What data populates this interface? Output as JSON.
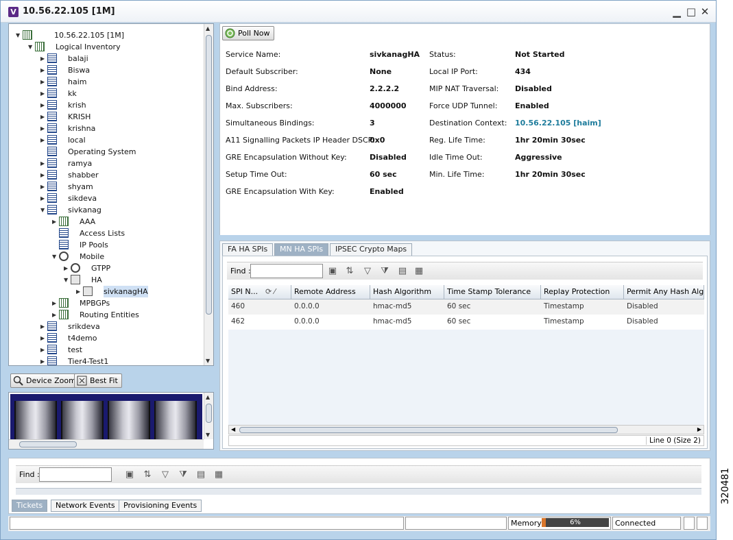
{
  "window": {
    "title": "10.56.22.105 [1M]",
    "icon_letter": "V"
  },
  "tree": [
    {
      "label": "10.56.22.105 [1M]",
      "depth": 0,
      "toggle": "▼",
      "icon": "network-element-icon"
    },
    {
      "label": "Logical Inventory",
      "depth": 1,
      "toggle": "▼",
      "icon": "logical-inventory-icon"
    },
    {
      "label": "balaji",
      "depth": 2,
      "toggle": "▶",
      "icon": "context-icon"
    },
    {
      "label": "Biswa",
      "depth": 2,
      "toggle": "▶",
      "icon": "context-icon"
    },
    {
      "label": "haim",
      "depth": 2,
      "toggle": "▶",
      "icon": "context-icon"
    },
    {
      "label": "kk",
      "depth": 2,
      "toggle": "▶",
      "icon": "context-icon"
    },
    {
      "label": "krish",
      "depth": 2,
      "toggle": "▶",
      "icon": "context-icon"
    },
    {
      "label": "KRISH",
      "depth": 2,
      "toggle": "▶",
      "icon": "context-icon"
    },
    {
      "label": "krishna",
      "depth": 2,
      "toggle": "▶",
      "icon": "context-icon"
    },
    {
      "label": "local",
      "depth": 2,
      "toggle": "▶",
      "icon": "context-icon"
    },
    {
      "label": "Operating System",
      "depth": 2,
      "toggle": "",
      "icon": "operating-system-icon"
    },
    {
      "label": "ramya",
      "depth": 2,
      "toggle": "▶",
      "icon": "context-icon"
    },
    {
      "label": "shabber",
      "depth": 2,
      "toggle": "▶",
      "icon": "context-icon"
    },
    {
      "label": "shyam",
      "depth": 2,
      "toggle": "▶",
      "icon": "context-icon"
    },
    {
      "label": "sikdeva",
      "depth": 2,
      "toggle": "▶",
      "icon": "context-icon"
    },
    {
      "label": "sivkanag",
      "depth": 2,
      "toggle": "▼",
      "icon": "context-icon"
    },
    {
      "label": "AAA",
      "depth": 3,
      "toggle": "▶",
      "icon": "aaa-icon"
    },
    {
      "label": "Access Lists",
      "depth": 3,
      "toggle": "",
      "icon": "access-list-icon"
    },
    {
      "label": "IP Pools",
      "depth": 3,
      "toggle": "",
      "icon": "ip-pool-icon"
    },
    {
      "label": "Mobile",
      "depth": 3,
      "toggle": "▼",
      "icon": "mobile-icon"
    },
    {
      "label": "GTPP",
      "depth": 4,
      "toggle": "▶",
      "icon": "gtpp-icon"
    },
    {
      "label": "HA",
      "depth": 4,
      "toggle": "▼",
      "icon": "ha-icon"
    },
    {
      "label": "sivkanagHA",
      "depth": 5,
      "toggle": "▶",
      "icon": "ha-service-icon",
      "selected": true
    },
    {
      "label": "MPBGPs",
      "depth": 3,
      "toggle": "▶",
      "icon": "mpbgp-icon"
    },
    {
      "label": "Routing Entities",
      "depth": 3,
      "toggle": "▶",
      "icon": "routing-entity-icon"
    },
    {
      "label": "srikdeva",
      "depth": 2,
      "toggle": "▶",
      "icon": "context-icon"
    },
    {
      "label": "t4demo",
      "depth": 2,
      "toggle": "▶",
      "icon": "context-icon"
    },
    {
      "label": "test",
      "depth": 2,
      "toggle": "▶",
      "icon": "context-icon"
    },
    {
      "label": "Tier4-Test1",
      "depth": 2,
      "toggle": "▶",
      "icon": "context-icon"
    }
  ],
  "zoom": {
    "device_zoom": "Device Zoom",
    "best_fit": "Best Fit"
  },
  "detail": {
    "poll_now": "Poll Now",
    "left_props": [
      {
        "label": "Service Name:",
        "value": "sivkanagHA"
      },
      {
        "label": "Default Subscriber:",
        "value": "None"
      },
      {
        "label": "Bind Address:",
        "value": "2.2.2.2"
      },
      {
        "label": "Max. Subscribers:",
        "value": "4000000"
      },
      {
        "label": "Simultaneous Bindings:",
        "value": "3"
      },
      {
        "label": "A11 Signalling Packets IP Header DSCP:",
        "value": "0x0"
      },
      {
        "label": "GRE Encapsulation Without Key:",
        "value": "Disabled"
      },
      {
        "label": "Setup Time Out:",
        "value": "60 sec"
      },
      {
        "label": "GRE Encapsulation With Key:",
        "value": "Enabled"
      }
    ],
    "right_props": [
      {
        "label": "Status:",
        "value": "Not Started",
        "link": false
      },
      {
        "label": "Local IP Port:",
        "value": "434",
        "link": false
      },
      {
        "label": "MIP NAT Traversal:",
        "value": "Disabled",
        "link": false
      },
      {
        "label": "Force UDP Tunnel:",
        "value": "Enabled",
        "link": false
      },
      {
        "label": "Destination Context:",
        "value": "10.56.22.105 [haim]",
        "link": true
      },
      {
        "label": "Reg. Life Time:",
        "value": "1hr 20min 30sec",
        "link": false
      },
      {
        "label": "Idle Time Out:",
        "value": "Aggressive",
        "link": false
      },
      {
        "label": "Min. Life Time:",
        "value": "1hr 20min 30sec",
        "link": false
      }
    ]
  },
  "spi_tabs": [
    "FA HA SPIs",
    "MN HA SPIs",
    "IPSEC Crypto Maps"
  ],
  "spi_tab_active": 1,
  "find_label": "Find :",
  "spi_table": {
    "columns": [
      "SPI N...",
      "Remote Address",
      "Hash Algorithm",
      "Time Stamp Tolerance",
      "Replay Protection",
      "Permit Any Hash Algorit"
    ],
    "rows": [
      [
        "460",
        "0.0.0.0",
        "hmac-md5",
        "60 sec",
        "Timestamp",
        "Disabled"
      ],
      [
        "462",
        "0.0.0.0",
        "hmac-md5",
        "60 sec",
        "Timestamp",
        "Disabled"
      ]
    ],
    "status": "Line 0 (Size 2)"
  },
  "events": {
    "find_label": "Find :",
    "tabs": [
      "Tickets",
      "Network Events",
      "Provisioning Events"
    ],
    "active_tab": 0
  },
  "status_bar": {
    "memory_label": "Memory:",
    "memory_percent": "6%",
    "memory_fraction": 0.06,
    "connection": "Connected"
  },
  "figure_number": "320481",
  "colors": {
    "accent": "#9eb1c4",
    "link": "#1e7c9c",
    "frame": "#b9d3ea",
    "memory_fill": "#d9762b"
  }
}
